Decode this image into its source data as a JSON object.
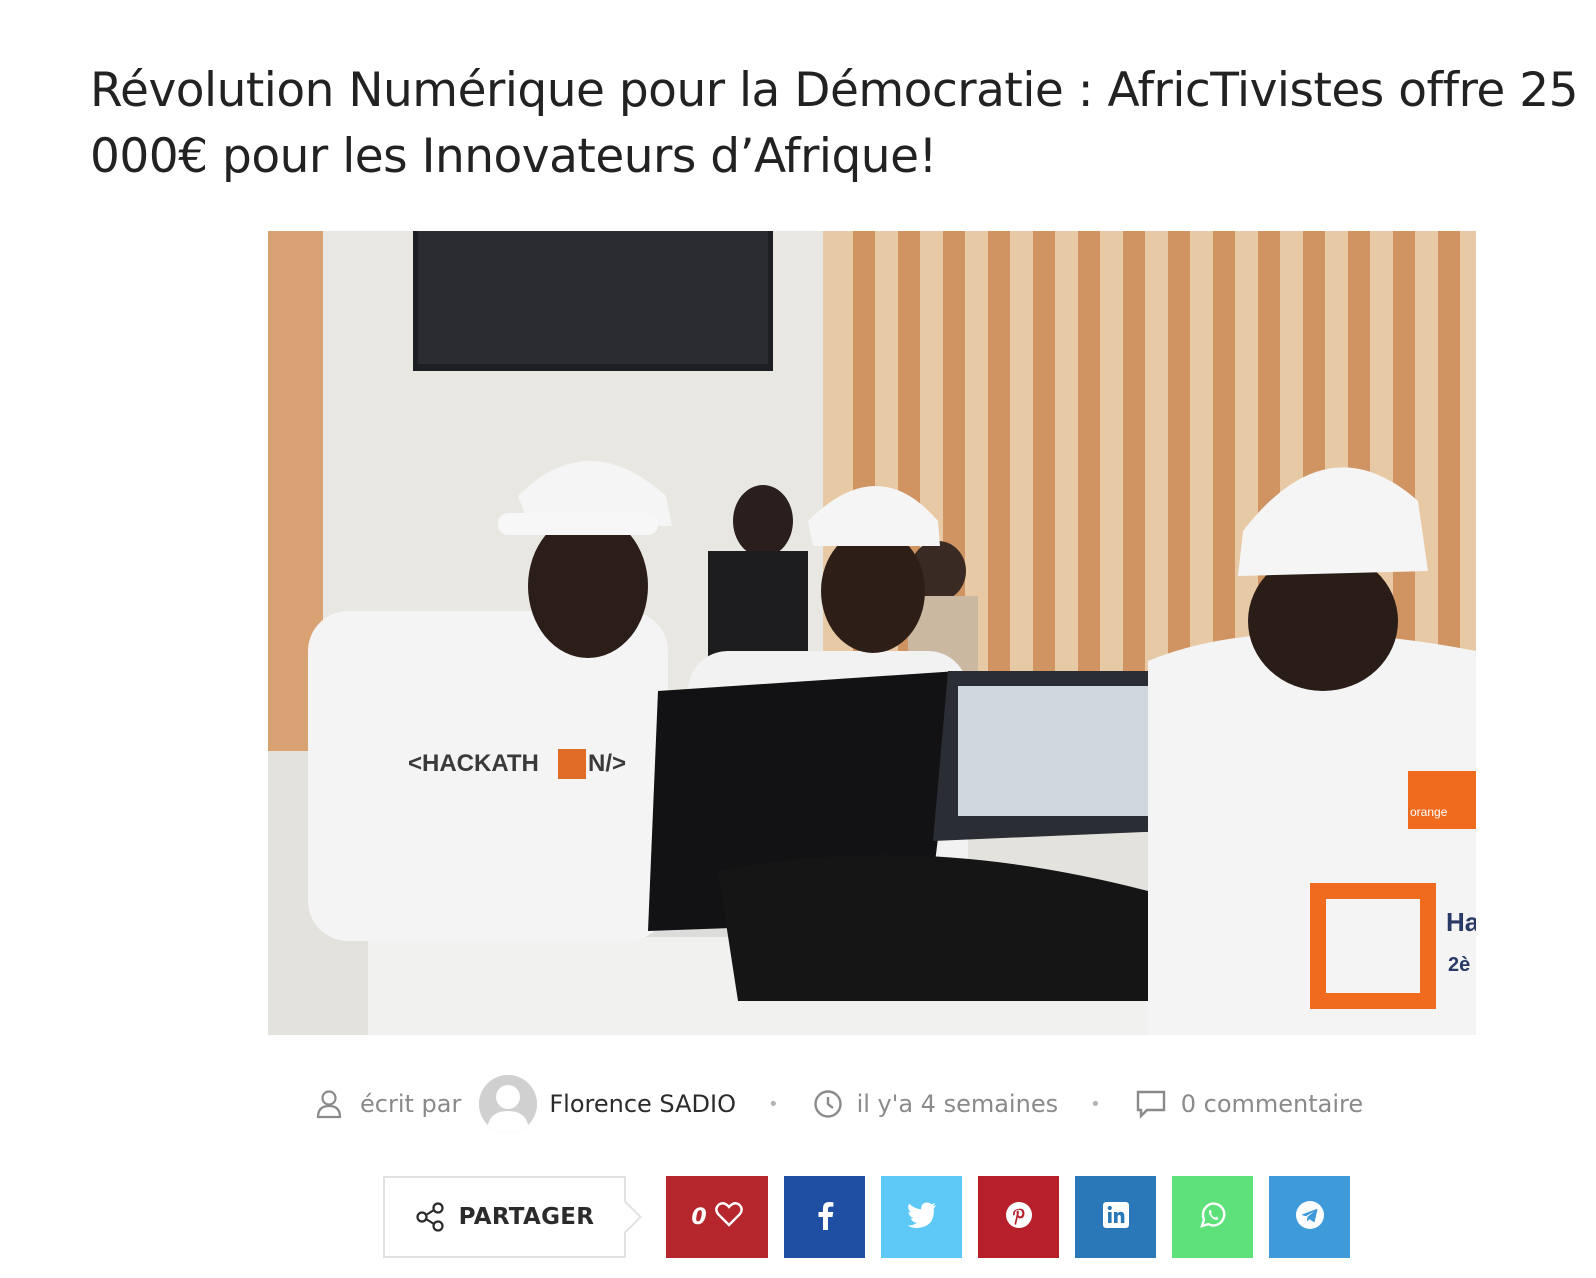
{
  "article": {
    "title": "Révolution Numérique pour la Démocratie : AfricTivistes offre 25 000€ pour les Innovateurs d’Afrique!",
    "image": {
      "shirt_text": "<HACKATH",
      "shirt_text_end": "N/>",
      "shirt_logo_top": "20",
      "shirt_logo_bottom": "16",
      "shirt_brand_partial": "Ha",
      "shirt_brand_partial_2": "2è",
      "orange_badge_text": "orange"
    }
  },
  "meta": {
    "author_icon": "user-icon",
    "written_by_label": "écrit par",
    "author_name": "Florence SADIO",
    "separator": "•",
    "date_icon": "clock-icon",
    "date_text": "il y'a 4 semaines",
    "comment_icon": "comment-icon",
    "comments_text": "0 commentaire"
  },
  "share": {
    "share_icon": "share-icon",
    "share_label": "PARTAGER",
    "like_count": "0",
    "buttons": [
      {
        "name": "facebook",
        "icon": "facebook-icon",
        "color": "#1e4fa3"
      },
      {
        "name": "twitter",
        "icon": "twitter-icon",
        "color": "#5ec8f7"
      },
      {
        "name": "pinterest",
        "icon": "pinterest-icon",
        "color": "#b71f2a"
      },
      {
        "name": "linkedin",
        "icon": "linkedin-icon",
        "color": "#2a78b8"
      },
      {
        "name": "whatsapp",
        "icon": "whatsapp-icon",
        "color": "#5ee07a"
      },
      {
        "name": "telegram",
        "icon": "telegram-icon",
        "color": "#3f9ad9"
      }
    ],
    "like_color": "#b5262d"
  }
}
